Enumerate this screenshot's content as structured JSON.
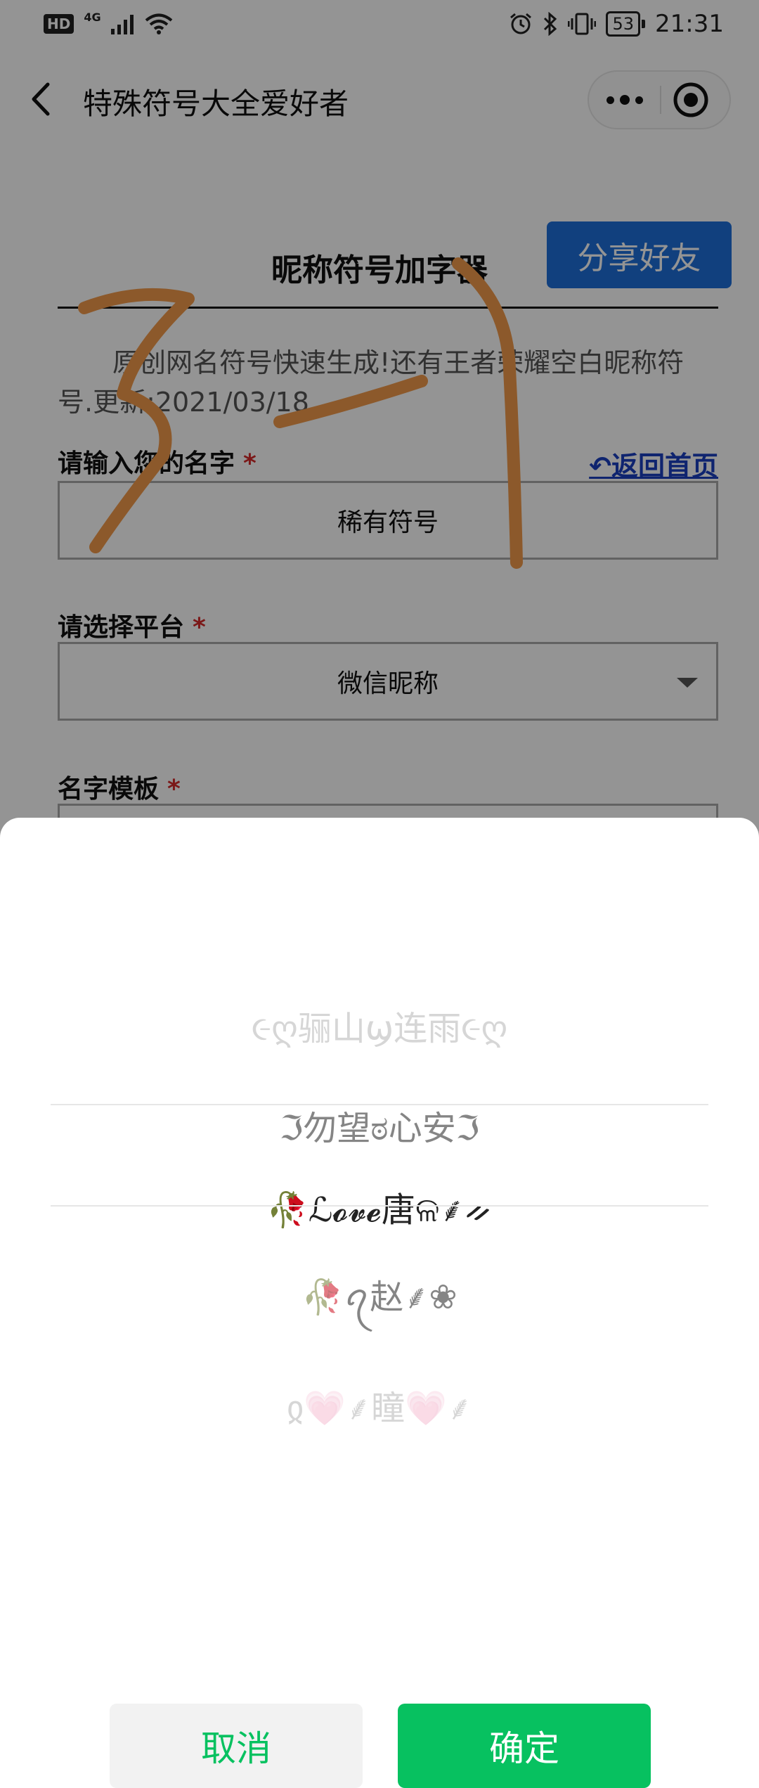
{
  "status_bar": {
    "hd": "HD",
    "network": "4G",
    "battery": "53",
    "time": "21:31"
  },
  "nav": {
    "title": "特殊符号大全爱好者"
  },
  "page": {
    "share_label": "分享好友",
    "title": "昵称符号加字器",
    "intro": "原创网名符号快速生成!还有王者荣耀空白昵称符号.更新:2021/03/18",
    "name_label": "请输入您的名字",
    "required_mark": "*",
    "home_link": "↶返回首页",
    "name_value": "稀有符号",
    "platform_label": "请选择平台",
    "platform_value": "微信昵称",
    "template_label": "名字模板"
  },
  "annotation": {
    "text": "3-1",
    "color": "#f29a4a"
  },
  "picker": {
    "items": [
      "૯ღ骊山ϣ连雨૯ღ",
      "ℑ勿望ಠ心安ℑ",
      "🥀ℒ𝓸𝓿𝓮唐ଳ⸙ᨀ",
      "🥀ꪖ赵⸙❀",
      "ჲ💗⸙瞳💗⸙"
    ],
    "selected_index": 2,
    "cancel_label": "取消",
    "confirm_label": "确定"
  },
  "colors": {
    "accent_green": "#07c160",
    "share_blue": "#1e6fd9",
    "required_red": "#d42a2a",
    "link_blue": "#1a3fc0"
  },
  "icons": [
    "back-arrow-icon",
    "more-dots-icon",
    "close-target-icon",
    "alarm-icon",
    "bluetooth-icon",
    "vibrate-icon",
    "wifi-icon",
    "signal-icon",
    "dropdown-caret-icon"
  ]
}
